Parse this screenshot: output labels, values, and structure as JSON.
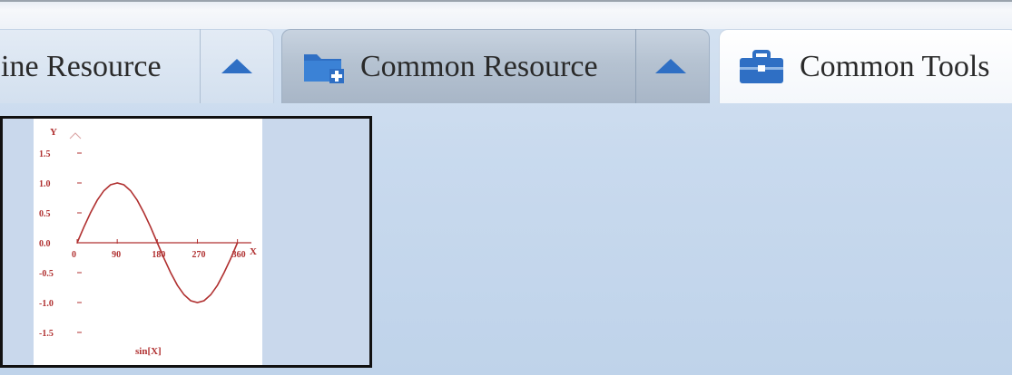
{
  "tabs": [
    {
      "label": "ine Resource",
      "state": "inactive"
    },
    {
      "label": "Common Resource",
      "state": "active"
    },
    {
      "label": "Common Tools",
      "state": "inactive"
    }
  ],
  "colors": {
    "accent": "#2f6fc4",
    "curve": "#b03030",
    "axis_text": "#b03030"
  },
  "icons": {
    "collapse": "triangle-up",
    "resource": "folder-plus-icon",
    "tools": "briefcase-icon"
  },
  "thumbnail": {
    "chart_data": {
      "type": "line",
      "title": "",
      "xlabel": "X",
      "ylabel": "Y",
      "caption": "sin[X]",
      "x": [
        0,
        15,
        30,
        45,
        60,
        75,
        90,
        105,
        120,
        135,
        150,
        165,
        180,
        195,
        210,
        225,
        240,
        255,
        270,
        285,
        300,
        315,
        330,
        345,
        360
      ],
      "series": [
        {
          "values": [
            0,
            0.26,
            0.5,
            0.71,
            0.87,
            0.97,
            1.0,
            0.97,
            0.87,
            0.71,
            0.5,
            0.26,
            0,
            -0.26,
            -0.5,
            -0.71,
            -0.87,
            -0.97,
            -1.0,
            -0.97,
            -0.87,
            -0.71,
            -0.5,
            -0.26,
            0
          ]
        }
      ],
      "xticks": [
        "0",
        "90",
        "180",
        "270",
        "360"
      ],
      "yticks": [
        "1.5",
        "1.0",
        "0.5",
        "0.0",
        "-0.5",
        "-1.0",
        "-1.5"
      ],
      "xlim": [
        0,
        375
      ],
      "ylim": [
        -1.5,
        1.5
      ]
    }
  }
}
